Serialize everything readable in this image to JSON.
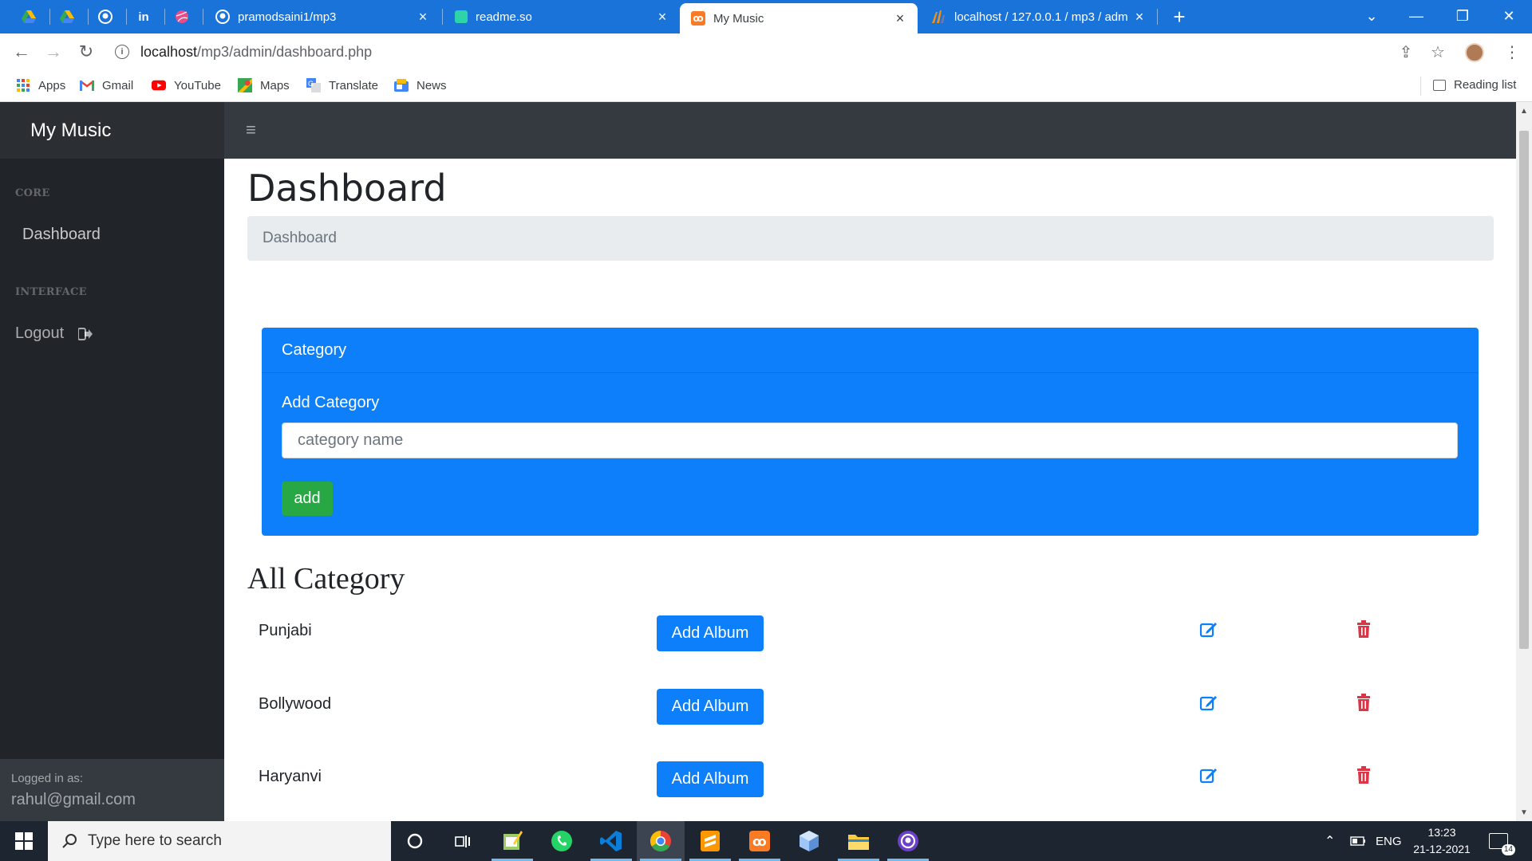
{
  "browser": {
    "tabs": [
      {
        "title": "pramodsaini1/mp3",
        "active": false
      },
      {
        "title": "readme.so",
        "active": false
      },
      {
        "title": "My Music",
        "active": true
      },
      {
        "title": "localhost / 127.0.0.1 / mp3 / adm",
        "active": false
      }
    ],
    "url_host": "localhost",
    "url_path": "/mp3/admin/dashboard.php",
    "bookmarks": [
      "Apps",
      "Gmail",
      "YouTube",
      "Maps",
      "Translate",
      "News"
    ],
    "reading_list": "Reading list"
  },
  "app": {
    "brand": "My Music",
    "toggler_icon": "≡",
    "sidebar": {
      "core_heading": "CORE",
      "dashboard_link": "Dashboard",
      "interface_heading": "INTERFACE",
      "logout_link": "Logout",
      "footer_label": "Logged in as:",
      "footer_email": "rahul@gmail.com"
    },
    "page_title": "Dashboard",
    "breadcrumb": "Dashboard",
    "category_card": {
      "header": "Category",
      "label": "Add Category",
      "input_placeholder": "category name",
      "input_value": "",
      "button": "add"
    },
    "all_category_title": "All Category",
    "categories": [
      {
        "name": "Punjabi",
        "album_button": "Add Album"
      },
      {
        "name": "Bollywood",
        "album_button": "Add Album"
      },
      {
        "name": "Haryanvi",
        "album_button": "Add Album"
      }
    ]
  },
  "taskbar": {
    "search_placeholder": "Type here to search",
    "language": "ENG",
    "time": "13:23",
    "date": "21-12-2021",
    "notification_count": "14"
  },
  "colors": {
    "chrome_blue": "#1a73d9",
    "primary": "#0d7ffb",
    "success": "#28a745",
    "danger": "#dc3545",
    "nav_dark": "#343a40",
    "sidebar_dark": "#212529"
  }
}
